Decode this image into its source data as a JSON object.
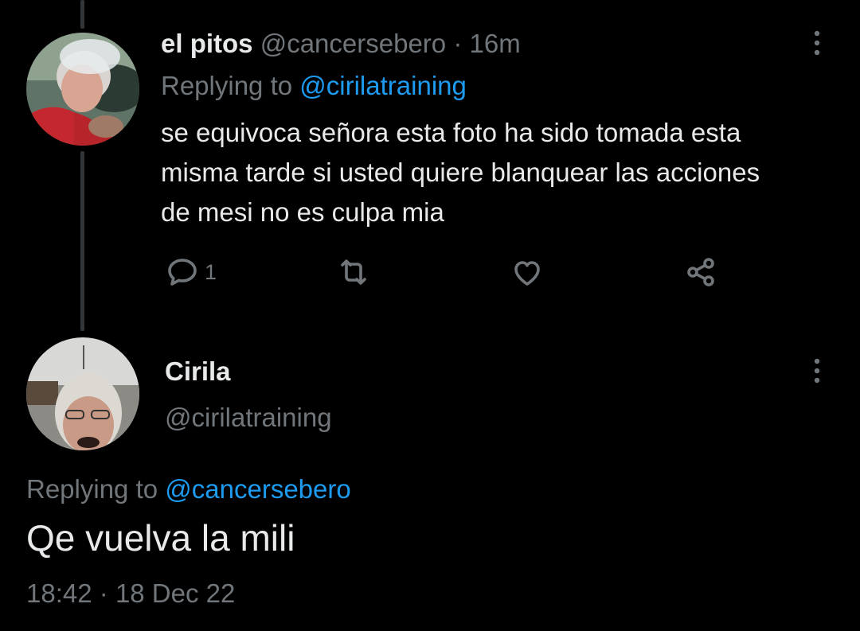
{
  "reply_tweet": {
    "display_name": "el pitos",
    "handle": "@cancersebero",
    "separator": "·",
    "time_ago": "16m",
    "replying_prefix": "Replying to",
    "replying_handle": "@cirilatraining",
    "text_lines": [
      "se equivoca señora esta foto ha sido tomada esta",
      "misma tarde si usted quiere blanquear las acciones",
      "de mesi no es culpa mia"
    ],
    "actions": {
      "reply_count": "1",
      "reply_icon": "reply-icon",
      "retweet_icon": "retweet-icon",
      "like_icon": "like-icon",
      "share_icon": "share-icon"
    }
  },
  "main_tweet": {
    "display_name": "Cirila",
    "handle": "@cirilatraining",
    "replying_prefix": "Replying to",
    "replying_handle": "@cancersebero",
    "text": "Qe vuelva la mili",
    "time": "18:42",
    "separator": "·",
    "date": "18 Dec 22"
  },
  "colors": {
    "background": "#000000",
    "text": "#e7e9ea",
    "muted": "#71767b",
    "link": "#1d9bf0",
    "thread_line": "#333639"
  }
}
